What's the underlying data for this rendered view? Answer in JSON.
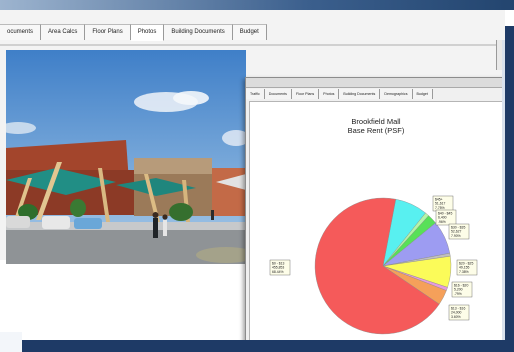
{
  "back_window": {
    "tabs": [
      {
        "label": "ocuments",
        "active": false
      },
      {
        "label": "Area Calcs",
        "active": false
      },
      {
        "label": "Floor Plans",
        "active": false
      },
      {
        "label": "Photos",
        "active": true
      },
      {
        "label": "Building Documents",
        "active": false
      },
      {
        "label": "Budget",
        "active": false
      }
    ]
  },
  "front_window": {
    "tabs": [
      {
        "label": "Traffic",
        "active": false
      },
      {
        "label": "Documents",
        "active": false
      },
      {
        "label": "Floor Plans",
        "active": false
      },
      {
        "label": "Photos",
        "active": false
      },
      {
        "label": "Building Documents",
        "active": false
      },
      {
        "label": "Demographics",
        "active": false
      },
      {
        "label": "Budget",
        "active": false
      }
    ]
  },
  "chart_data": {
    "type": "pie",
    "title": "Brookfield Mall",
    "subtitle": "Base Rent (PSF)",
    "slices": [
      {
        "label": "$0 - $13",
        "sqft": "455,853",
        "percent": 68.44,
        "percent_text": "68.44%",
        "color": "#f55a5a"
      },
      {
        "label": "$13 - $16",
        "sqft": "24,000",
        "percent": 3.6,
        "percent_text": "3.60%",
        "color": "#f5a05a"
      },
      {
        "label": "$16 - $20",
        "sqft": "5,200",
        "percent": 0.79,
        "percent_text": ".79%",
        "color": "#e69ae0"
      },
      {
        "label": "$20 - $25",
        "sqft": "49,155",
        "percent": 7.38,
        "percent_text": "7.38%",
        "color": "#fbfb59"
      },
      {
        "label": "$25 - $30",
        "sqft": "4,800",
        "percent": 0.72,
        "percent_text": ".72%",
        "color": "#c0c0c0"
      },
      {
        "label": "$30 - $35",
        "sqft": "52,627",
        "percent": 7.9,
        "percent_text": "7.90%",
        "color": "#9d9cf2"
      },
      {
        "label": "$35 - $40",
        "sqft": "15,627",
        "percent": 2.35,
        "percent_text": "2.35%",
        "color": "#58e058"
      },
      {
        "label": "$40 - $45",
        "sqft": "6,400",
        "percent": 0.96,
        "percent_text": ".96%",
        "color": "#b4f5a8"
      },
      {
        "label": "$45+",
        "sqft": "51,617",
        "percent": 7.75,
        "percent_text": "7.75%",
        "color": "#58f0f0"
      }
    ]
  }
}
